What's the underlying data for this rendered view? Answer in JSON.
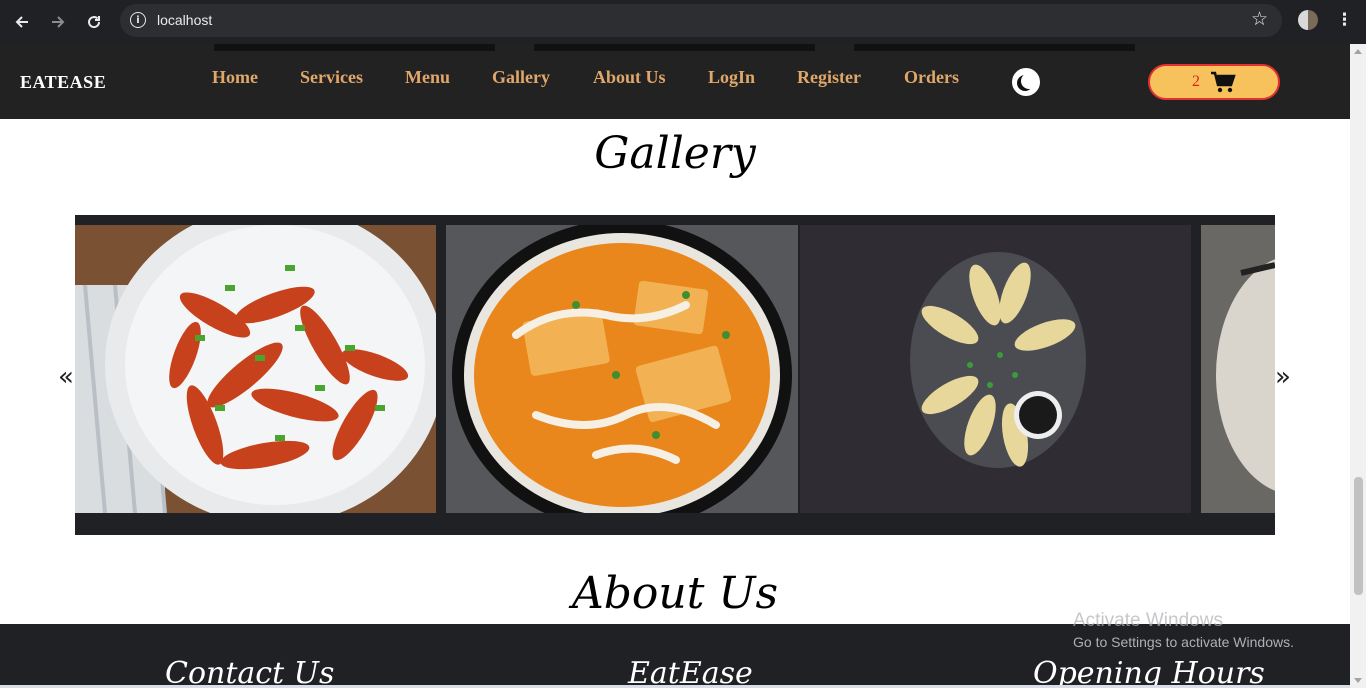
{
  "browser": {
    "url": "localhost",
    "back_icon": "arrow-left-icon",
    "forward_icon": "arrow-right-icon",
    "reload_icon": "reload-icon"
  },
  "header": {
    "brand": "EATEASE",
    "nav": [
      "Home",
      "Services",
      "Menu",
      "Gallery",
      "About Us",
      "LogIn",
      "Register",
      "Orders"
    ],
    "cart_count": "2",
    "colors": {
      "nav_link": "#e0a76a",
      "cart_bg": "#f7c25b",
      "cart_border": "#e53030",
      "header_bg": "#222222"
    }
  },
  "gallery": {
    "title": "Gallery",
    "prev": "«",
    "next": "»",
    "slides": [
      "Crispy sesame potato fingers",
      "Paneer butter masala",
      "Momos with dipping sauce",
      "Noodle bowl (partially visible)"
    ]
  },
  "about": {
    "title": "About Us"
  },
  "footer": {
    "col1": "Contact Us",
    "col2": "EatEase",
    "col3": "Opening Hours"
  },
  "windows_watermark": {
    "line1": "Activate Windows",
    "line2": "Go to Settings to activate Windows."
  }
}
